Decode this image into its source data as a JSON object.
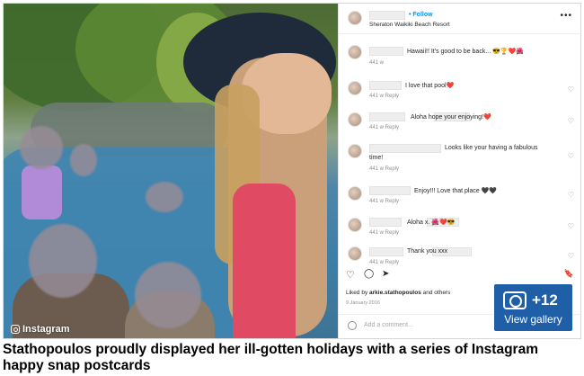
{
  "photo": {
    "watermark": "Instagram"
  },
  "post_header": {
    "follow_label": "• Follow",
    "location": "Sheraton Waikiki Beach Resort",
    "more_label": "•••"
  },
  "comments": [
    {
      "text": "Hawaii!! It's good to be back... 😎🏆❤️🌺",
      "meta": "441 w"
    },
    {
      "text": "I love that pool❤️",
      "meta": "441 w   Reply"
    },
    {
      "text": "Aloha             hope your enjoying!❤️",
      "meta": "441 w   Reply"
    },
    {
      "text": "Looks like your having a fabulous",
      "text2": "time!",
      "meta": "441 w   Reply"
    },
    {
      "text": "Enjoy!!! Love that place 🖤🖤",
      "meta": "441 w   Reply"
    },
    {
      "text": "Aloha             x. 🌺❤️😎",
      "meta": "441 w   Reply"
    },
    {
      "text": "Thank you             xxx",
      "meta": "441 w   Reply"
    }
  ],
  "actions": {
    "heart": "♡",
    "comment": "◯",
    "share": "➤",
    "bookmark": "🔖"
  },
  "liked_by": {
    "prefix": "Liked by ",
    "user": "arkie.stathopoulos",
    "suffix": " and others"
  },
  "post_date": "9 January 2016",
  "add_comment_placeholder": "Add a comment...",
  "gallery": {
    "count": "+12",
    "label": "View gallery"
  },
  "caption": "Stathopoulos proudly displayed her ill-gotten holidays with a series of Instagram happy snap postcards"
}
